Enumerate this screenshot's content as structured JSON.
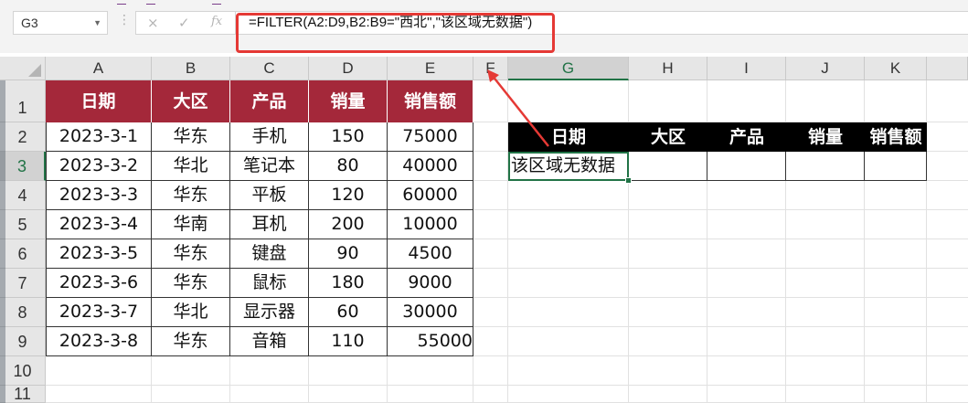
{
  "namebox": {
    "value": "G3"
  },
  "formula_bar": {
    "cancel_icon": "×",
    "enter_icon": "✓",
    "fx_icon": "fx",
    "formula": "=FILTER(A2:D9,B2:B9=\"西北\",\"该区域无数据\")"
  },
  "columns": [
    "A",
    "B",
    "C",
    "D",
    "E",
    "F",
    "G",
    "H",
    "I",
    "J",
    "K"
  ],
  "rows": [
    "1",
    "2",
    "3",
    "4",
    "5",
    "6",
    "7",
    "8",
    "9",
    "10",
    "11"
  ],
  "table1": {
    "headers": [
      "日期",
      "大区",
      "产品",
      "销量",
      "销售额"
    ],
    "rows": [
      [
        "2023-3-1",
        "华东",
        "手机",
        "150",
        "75000"
      ],
      [
        "2023-3-2",
        "华北",
        "笔记本",
        "80",
        "40000"
      ],
      [
        "2023-3-3",
        "华东",
        "平板",
        "120",
        "60000"
      ],
      [
        "2023-3-4",
        "华南",
        "耳机",
        "200",
        "10000"
      ],
      [
        "2023-3-5",
        "华东",
        "键盘",
        "90",
        "4500"
      ],
      [
        "2023-3-6",
        "华东",
        "鼠标",
        "180",
        "9000"
      ],
      [
        "2023-3-7",
        "华北",
        "显示器",
        "60",
        "30000"
      ],
      [
        "2023-3-8",
        "华东",
        "音箱",
        "110",
        "55000"
      ]
    ]
  },
  "table2": {
    "headers": [
      "日期",
      "大区",
      "产品",
      "销量",
      "销售额"
    ],
    "result": [
      "该区域无数据",
      "",
      "",
      "",
      ""
    ]
  },
  "colors": {
    "header_red": "#a4283a",
    "selection_green": "#217346",
    "annotation_red": "#e53935"
  }
}
